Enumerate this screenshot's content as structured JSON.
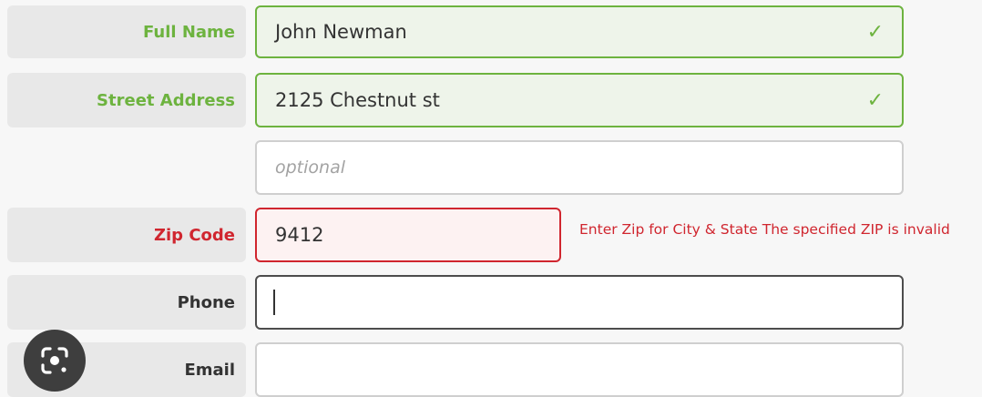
{
  "form": {
    "full_name": {
      "label": "Full Name",
      "value": "John Newman",
      "state": "valid"
    },
    "street_address": {
      "label": "Street Address",
      "value": "2125 Chestnut st",
      "state": "valid"
    },
    "address_line2": {
      "placeholder": "optional",
      "value": ""
    },
    "zip_code": {
      "label": "Zip Code",
      "value": "9412",
      "state": "invalid",
      "error": "Enter Zip for City & State The specified ZIP is invalid"
    },
    "phone": {
      "label": "Phone",
      "value": "",
      "state": "focused"
    },
    "email": {
      "label": "Email",
      "value": ""
    }
  },
  "icons": {
    "valid": "check-icon",
    "lens": "google-lens-icon"
  },
  "colors": {
    "valid": "#6db33f",
    "invalid": "#d0262f",
    "label_bg": "#e8e8e8",
    "page_bg": "#f7f7f7"
  }
}
